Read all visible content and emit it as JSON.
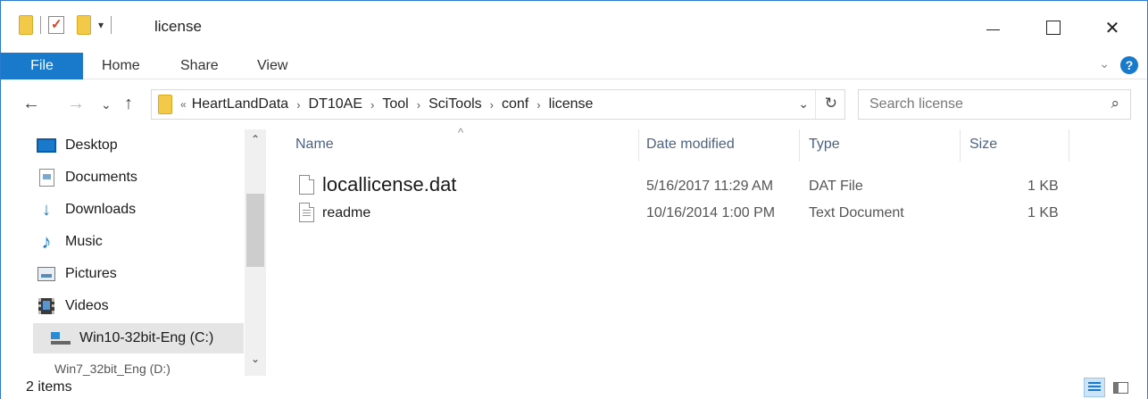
{
  "window": {
    "title": "license",
    "controls": {
      "minimize": "—",
      "maximize": "☐",
      "close": "✕"
    }
  },
  "quick_access": {
    "dropdown_glyph": "▾"
  },
  "ribbon": {
    "tabs": [
      "File",
      "Home",
      "Share",
      "View"
    ],
    "expand_glyph": "⌄",
    "help_glyph": "?"
  },
  "nav": {
    "back": "←",
    "forward": "→",
    "recent": "⌄",
    "up": "↑",
    "overflow": "«",
    "breadcrumb": [
      "HeartLandData",
      "DT10AE",
      "Tool",
      "SciTools",
      "conf",
      "license"
    ],
    "crumb_separator": "›",
    "dropdown": "⌄",
    "refresh": "↻"
  },
  "search": {
    "placeholder": "Search license",
    "icon": "⌕"
  },
  "navpane": {
    "items": [
      {
        "label": "Desktop",
        "icon": "desktop-icon"
      },
      {
        "label": "Documents",
        "icon": "documents-icon"
      },
      {
        "label": "Downloads",
        "icon": "downloads-icon"
      },
      {
        "label": "Music",
        "icon": "music-icon"
      },
      {
        "label": "Pictures",
        "icon": "pictures-icon"
      },
      {
        "label": "Videos",
        "icon": "videos-icon"
      },
      {
        "label": "Win10-32bit-Eng (C:)",
        "icon": "drive-icon",
        "selected": true
      }
    ],
    "cutoff_item": "Win7_32bit_Eng (D:)",
    "scroll_up": "⌃",
    "scroll_down": "⌄"
  },
  "columns": {
    "name": "Name",
    "date": "Date modified",
    "type": "Type",
    "size": "Size",
    "sort_glyph": "^"
  },
  "files": [
    {
      "name": "locallicense.dat",
      "date": "5/16/2017 11:29 AM",
      "type": "DAT File",
      "size": "1 KB"
    },
    {
      "name": "readme",
      "date": "10/16/2014 1:00 PM",
      "type": "Text Document",
      "size": "1 KB"
    }
  ],
  "status": {
    "items": "2 items"
  },
  "accent": "#1979ca"
}
